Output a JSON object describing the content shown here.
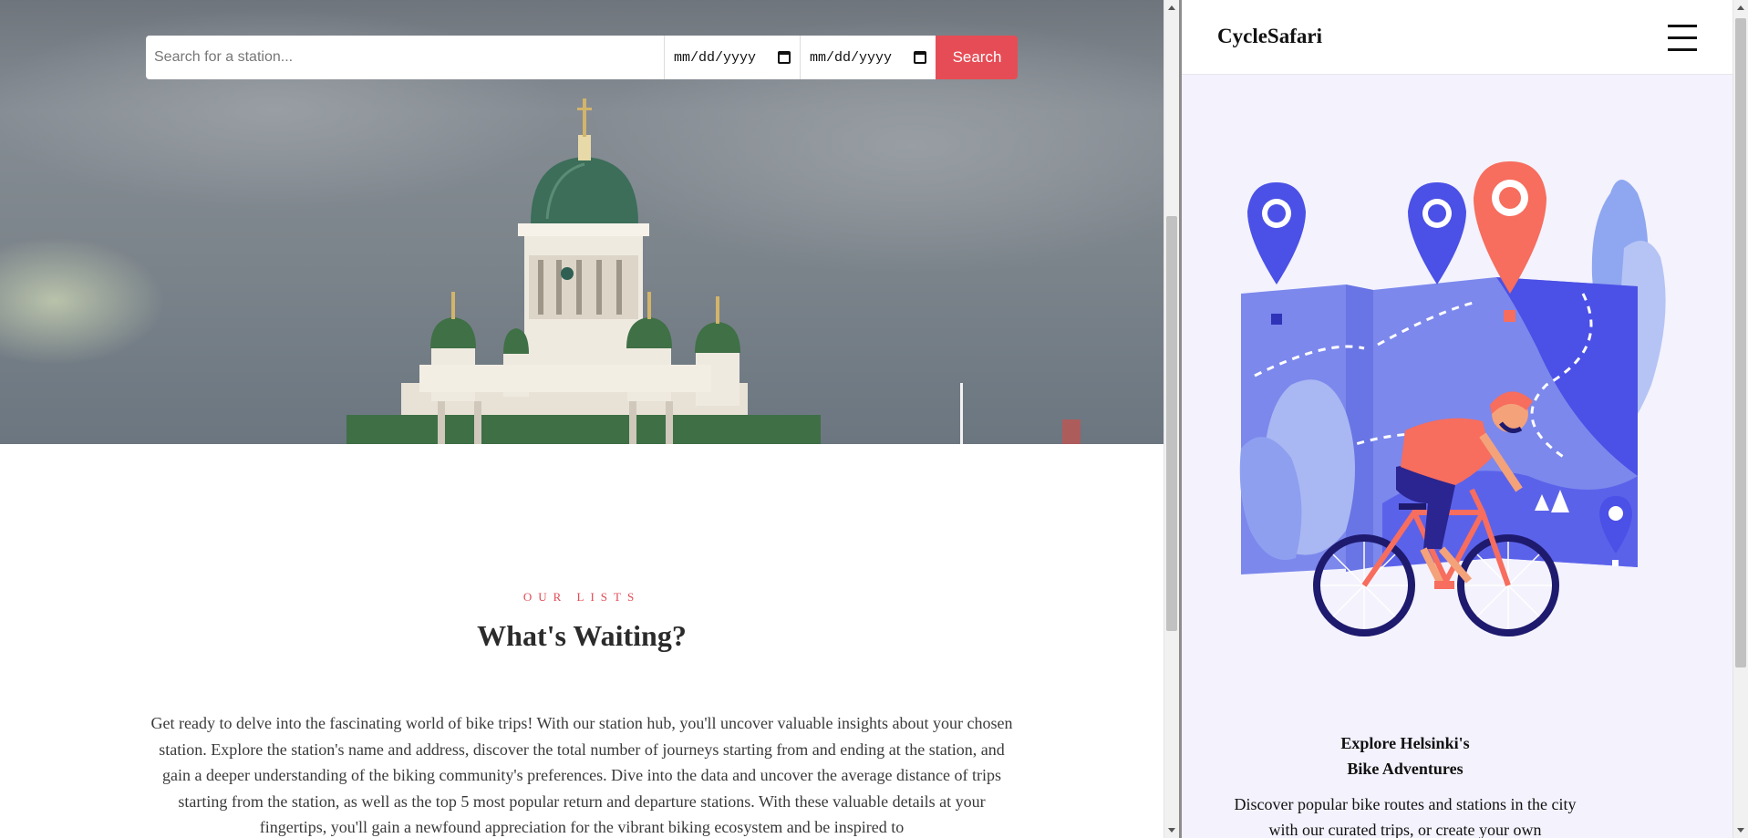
{
  "search": {
    "placeholder": "Search for a station...",
    "start_date": "mm/dd/yyyy",
    "end_date": "mm/dd/yyyy",
    "button_label": "Search",
    "button_color": "#e64c55"
  },
  "lists": {
    "eyebrow": "OUR LISTS",
    "title": "What's Waiting?",
    "body": "Get ready to delve into the fascinating world of bike trips! With our station hub, you'll uncover valuable insights about your chosen station. Explore the station's name and address, discover the total number of journeys starting from and ending at the station, and gain a deeper understanding of the biking community's preferences. Dive into the data and uncover the average distance of trips starting from the station, as well as the top 5 most popular return and departure stations. With these valuable details at your fingertips, you'll gain a newfound appreciation for the vibrant biking ecosystem and be inspired to"
  },
  "sidebar": {
    "brand": "CycleSafari",
    "menu_icon": "hamburger-menu-icon",
    "info_title_line1": "Explore Helsinki's",
    "info_title_line2": "Bike Adventures",
    "info_text": "Discover popular bike routes and stations in the city with our curated trips, or create your own",
    "background_color": "#f3f2fd",
    "accent_color": "#4b50e6",
    "pin_color": "#f76d5e"
  }
}
